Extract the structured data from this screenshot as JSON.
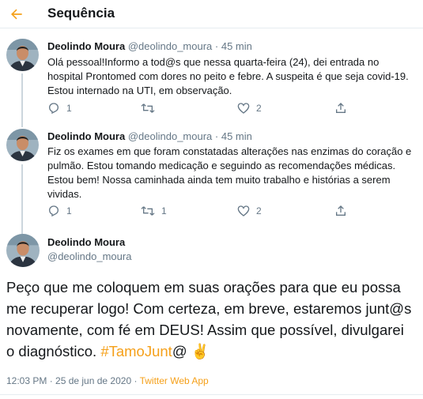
{
  "header": {
    "title": "Sequência"
  },
  "tweets": [
    {
      "name": "Deolindo Moura",
      "handle": "@deolindo_moura",
      "time": "· 45 min",
      "text": "Olá pessoal!Informo a tod@s que nessa quarta-feira (24), dei entrada no hospital Prontomed com dores no peito e febre. A suspeita é que seja covid-19. Estou internado na UTI, em observação.",
      "replies": "1",
      "retweets": "",
      "likes": "2"
    },
    {
      "name": "Deolindo Moura",
      "handle": "@deolindo_moura",
      "time": "· 45 min",
      "text": "Fiz os exames em que foram constatadas alterações nas enzimas do coração e pulmão. Estou tomando medicação e seguindo as recomendações médicas. Estou bem! Nossa caminhada ainda tem muito trabalho e histórias a serem vividas.",
      "replies": "1",
      "retweets": "1",
      "likes": "2"
    }
  ],
  "main_tweet": {
    "name": "Deolindo Moura",
    "handle": "@deolindo_moura",
    "text": "Peço que me coloquem em suas orações para que eu possa me recuperar logo! Com certeza, em breve, estaremos junt@s novamente, com fé em DEUS! Assim que possível, divulgarei o diagnóstico. ",
    "hashtag": "#TamoJunt",
    "text_after": "@ ✌️",
    "timestamp": "12:03 PM · 25 de jun de 2020 · ",
    "source_app": "Twitter Web App"
  },
  "icons": {
    "back": "arrow-left-icon",
    "reply": "reply-icon",
    "retweet": "retweet-icon",
    "like": "heart-icon",
    "share": "share-icon"
  },
  "colors": {
    "accent": "#f5a01a",
    "text": "#14171a",
    "secondary": "#657786",
    "border": "#e6ecf0"
  }
}
